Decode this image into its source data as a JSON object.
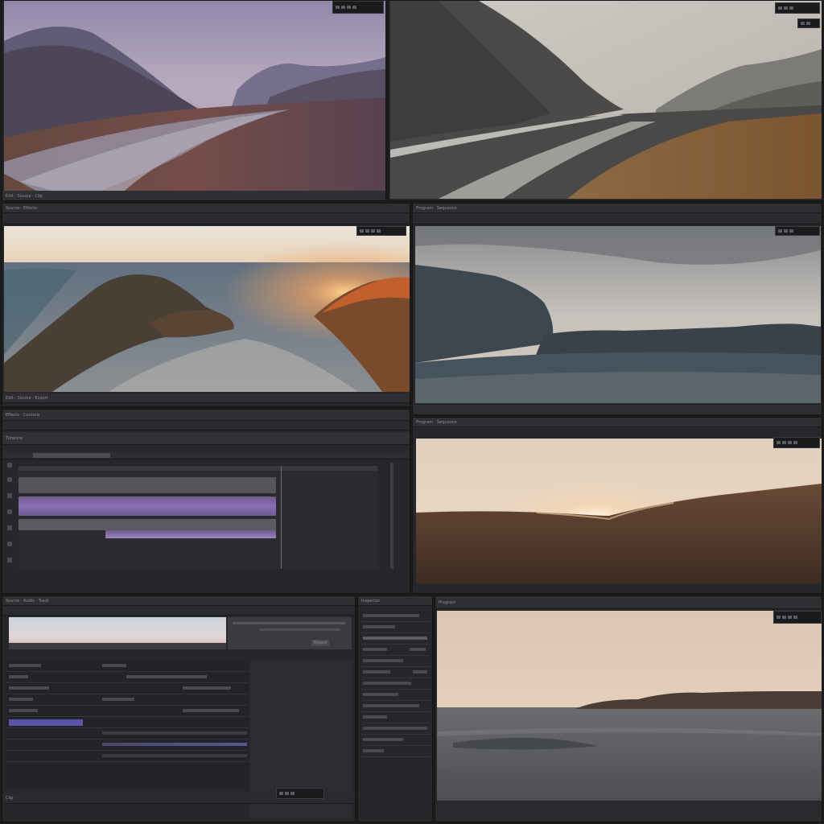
{
  "panels": {
    "top_left": {
      "footer_label": "Edit · Source · Clip"
    },
    "top_right": {
      "header_label": ""
    },
    "mid_left": {
      "header_label": "Source · Effects",
      "footer_label": "Edit · Source · Export"
    },
    "mid_right": {
      "header_label": "Program · Sequence"
    },
    "timeline": {
      "header_label": "Effects · Controls",
      "subheader_label": "Timeline"
    },
    "low_right": {
      "header_label": "Program · Sequence"
    },
    "editor": {
      "header_label": "Source · Audio · Track",
      "button_label": "Export",
      "bottom_label": "Clip"
    },
    "inspector": {
      "header_label": "Inspector"
    },
    "viewer": {
      "header_label": "Program"
    }
  },
  "colors": {
    "accent_purple": "#8a6fb5",
    "track_gray": "#55565c",
    "panel_bg": "#26272a",
    "app_bg": "#1c1c1d"
  },
  "icons": [
    "play-icon",
    "pause-icon",
    "step-forward-icon",
    "step-back-icon",
    "fullscreen-icon"
  ]
}
